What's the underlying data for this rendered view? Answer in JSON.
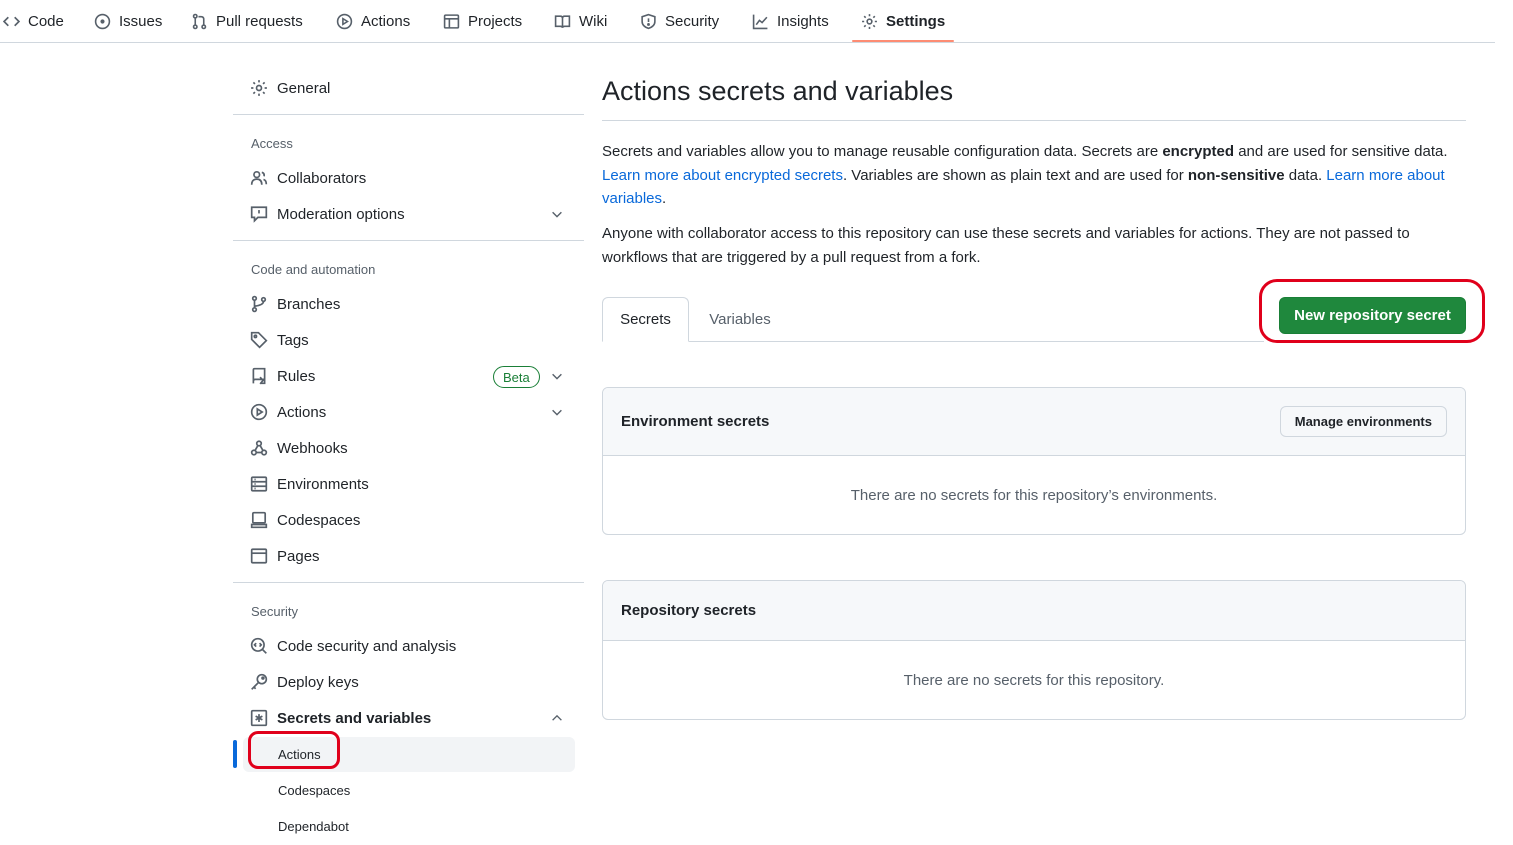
{
  "topnav": {
    "tabs": [
      {
        "label": "Code",
        "icon": "code-icon"
      },
      {
        "label": "Issues",
        "icon": "issue-opened-icon"
      },
      {
        "label": "Pull requests",
        "icon": "pull-request-icon"
      },
      {
        "label": "Actions",
        "icon": "play-icon"
      },
      {
        "label": "Projects",
        "icon": "table-icon"
      },
      {
        "label": "Wiki",
        "icon": "book-icon"
      },
      {
        "label": "Security",
        "icon": "shield-icon"
      },
      {
        "label": "Insights",
        "icon": "graph-icon"
      },
      {
        "label": "Settings",
        "icon": "gear-icon",
        "active": true
      }
    ]
  },
  "sidebar": {
    "general": "General",
    "access": {
      "heading": "Access",
      "items": [
        "Collaborators",
        "Moderation options"
      ]
    },
    "code_automation": {
      "heading": "Code and automation",
      "items": [
        "Branches",
        "Tags",
        "Rules",
        "Actions",
        "Webhooks",
        "Environments",
        "Codespaces",
        "Pages"
      ],
      "rules_badge": "Beta"
    },
    "security": {
      "heading": "Security",
      "items": [
        "Code security and analysis",
        "Deploy keys",
        "Secrets and variables"
      ],
      "sub_items": [
        "Actions",
        "Codespaces",
        "Dependabot"
      ],
      "active_sub_item": "Actions"
    }
  },
  "main": {
    "title": "Actions secrets and variables",
    "desc1": {
      "t1": "Secrets and variables allow you to manage reusable configuration data. Secrets are ",
      "b1": "encrypted",
      "t2": " and are used for sensitive data. ",
      "link1": "Learn more about encrypted secrets",
      "t3": ". Variables are shown as plain text and are used for ",
      "b2": "non-sensitive",
      "t4": " data. ",
      "link2": "Learn more about variables",
      "t5": "."
    },
    "desc2": "Anyone with collaborator access to this repository can use these secrets and variables for actions. They are not passed to workflows that are triggered by a pull request from a fork.",
    "tabs": [
      "Secrets",
      "Variables"
    ],
    "active_tab": "Secrets",
    "new_secret_button": "New repository secret",
    "env_secrets": {
      "title": "Environment secrets",
      "button": "Manage environments",
      "empty": "There are no secrets for this repository’s environments."
    },
    "repo_secrets": {
      "title": "Repository secrets",
      "empty": "There are no secrets for this repository."
    }
  },
  "colors": {
    "primary_button": "#1f883d",
    "link": "#0969da",
    "active_tab_underline": "#fd8c73",
    "annotation": "#e0001b"
  }
}
